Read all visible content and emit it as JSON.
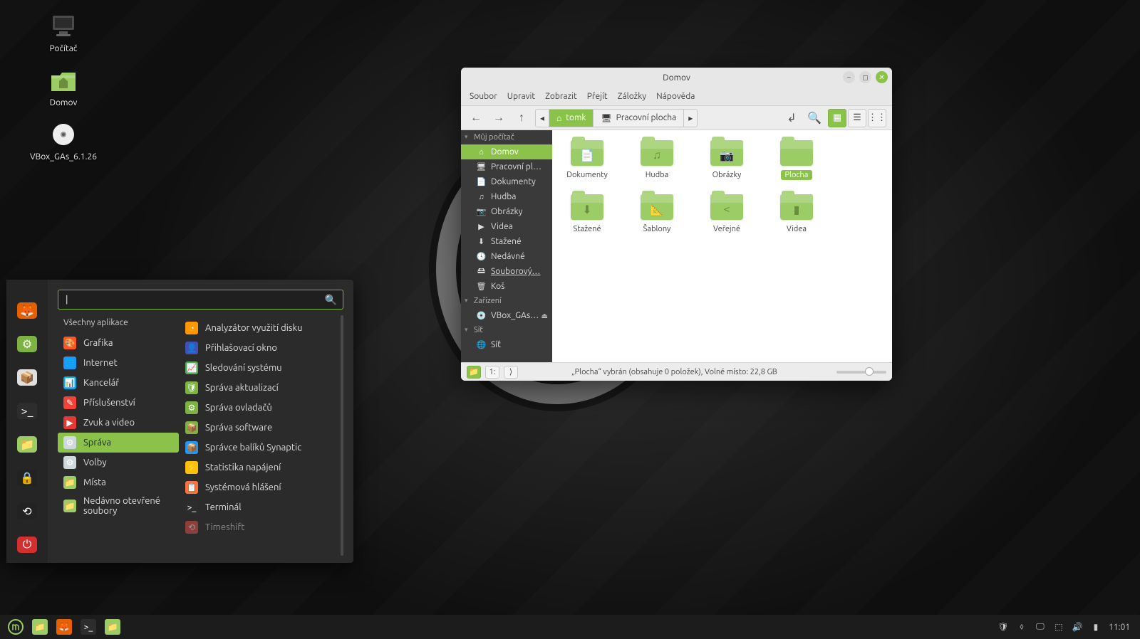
{
  "desktop": {
    "icons": [
      {
        "name": "computer",
        "label": "Počítač"
      },
      {
        "name": "home",
        "label": "Domov"
      },
      {
        "name": "cdrom",
        "label": "VBox_GAs_6.1.26"
      }
    ]
  },
  "file_manager": {
    "title": "Domov",
    "menu": [
      "Soubor",
      "Upravit",
      "Zobrazit",
      "Přejít",
      "Záložky",
      "Nápověda"
    ],
    "path": [
      "tomk",
      "Pracovní plocha"
    ],
    "sidebar": {
      "computer_header": "Můj počítač",
      "computer_items": [
        {
          "icon": "home",
          "label": "Domov",
          "active": true
        },
        {
          "icon": "desktop",
          "label": "Pracovní pl…"
        },
        {
          "icon": "doc",
          "label": "Dokumenty"
        },
        {
          "icon": "music",
          "label": "Hudba"
        },
        {
          "icon": "image",
          "label": "Obrázky"
        },
        {
          "icon": "video",
          "label": "Videa"
        },
        {
          "icon": "download",
          "label": "Stažené"
        },
        {
          "icon": "recent",
          "label": "Nedávné"
        },
        {
          "icon": "disk",
          "label": "Souborový…",
          "link": true
        },
        {
          "icon": "trash",
          "label": "Koš"
        }
      ],
      "devices_header": "Zařízení",
      "devices_items": [
        {
          "icon": "cd",
          "label": "VBox_GAs…",
          "eject": true
        }
      ],
      "network_header": "Síť",
      "network_items": [
        {
          "icon": "net",
          "label": "Síť"
        }
      ]
    },
    "files": [
      {
        "label": "Dokumenty",
        "glyph": "📄"
      },
      {
        "label": "Hudba",
        "glyph": "♫"
      },
      {
        "label": "Obrázky",
        "glyph": "📷"
      },
      {
        "label": "Plocha",
        "glyph": "",
        "selected": true
      },
      {
        "label": "Stažené",
        "glyph": "⬇"
      },
      {
        "label": "Šablony",
        "glyph": "📐"
      },
      {
        "label": "Veřejné",
        "glyph": "<"
      },
      {
        "label": "Videa",
        "glyph": "▮"
      }
    ],
    "status_text": "„Plocha“ vybrán (obsahuje 0 položek), Volné místo: 22,8 GB"
  },
  "app_menu": {
    "search_value": "|",
    "all_apps_label": "Všechny aplikace",
    "favorites": [
      {
        "name": "firefox",
        "bg": "#e66000",
        "glyph": "🦊"
      },
      {
        "name": "onboard",
        "bg": "#7cb342",
        "glyph": "⚙"
      },
      {
        "name": "software",
        "bg": "#e0e0e0",
        "glyph": "📦"
      },
      {
        "name": "terminal",
        "bg": "#2d2d2d",
        "glyph": ">_"
      },
      {
        "name": "files",
        "bg": "#9ccc65",
        "glyph": "📁"
      },
      {
        "name": "lock",
        "bg": "#222",
        "glyph": "🔒"
      },
      {
        "name": "logout",
        "bg": "#222",
        "glyph": "⟲"
      },
      {
        "name": "power",
        "bg": "#d32f2f",
        "glyph": "⏻"
      }
    ],
    "categories": [
      {
        "label": "Grafika",
        "bg": "#ff5722",
        "glyph": "🎨"
      },
      {
        "label": "Internet",
        "bg": "#2196f3",
        "glyph": "🌐"
      },
      {
        "label": "Kancelář",
        "bg": "#03a9f4",
        "glyph": "📊"
      },
      {
        "label": "Příslušenství",
        "bg": "#f44336",
        "glyph": "✎"
      },
      {
        "label": "Zvuk a video",
        "bg": "#e53935",
        "glyph": "▶"
      },
      {
        "label": "Správa",
        "bg": "#cfd8dc",
        "glyph": "⚙",
        "active": true
      },
      {
        "label": "Volby",
        "bg": "#cfd8dc",
        "glyph": "⚙"
      },
      {
        "label": "Místa",
        "bg": "#9ccc65",
        "glyph": "📁"
      },
      {
        "label": "Nedávno otevřené soubory",
        "bg": "#9ccc65",
        "glyph": "📁"
      }
    ],
    "apps": [
      {
        "label": "Analyzátor využití disku",
        "bg": "#ff9800",
        "glyph": "◔"
      },
      {
        "label": "Přihlašovací okno",
        "bg": "#3f51b5",
        "glyph": "👤"
      },
      {
        "label": "Sledování systému",
        "bg": "#4caf50",
        "glyph": "📈"
      },
      {
        "label": "Správa aktualizací",
        "bg": "#7cb342",
        "glyph": "🛡"
      },
      {
        "label": "Správa ovladačů",
        "bg": "#7cb342",
        "glyph": "⚙"
      },
      {
        "label": "Správa software",
        "bg": "#7cb342",
        "glyph": "📦"
      },
      {
        "label": "Správce balíků Synaptic",
        "bg": "#2196f3",
        "glyph": "📦"
      },
      {
        "label": "Statistika napájení",
        "bg": "#ffc107",
        "glyph": "⚡"
      },
      {
        "label": "Systémová hlášení",
        "bg": "#ff7043",
        "glyph": "📋"
      },
      {
        "label": "Terminál",
        "bg": "#2d2d2d",
        "glyph": ">_"
      },
      {
        "label": "Timeshift",
        "bg": "#ef5350",
        "glyph": "⟲",
        "dim": true
      }
    ]
  },
  "taskbar": {
    "time": "11:01",
    "launchers": [
      {
        "name": "menu",
        "glyph": "◎",
        "bg": ""
      },
      {
        "name": "show-desktop",
        "glyph": "📁",
        "bg": "#9ccc65"
      },
      {
        "name": "firefox",
        "glyph": "🦊",
        "bg": "#e66000"
      },
      {
        "name": "terminal",
        "glyph": ">_",
        "bg": "#2d2d2d"
      },
      {
        "name": "files",
        "glyph": "📁",
        "bg": "#9ccc65"
      }
    ],
    "tray": [
      {
        "name": "updates",
        "glyph": "🛡"
      },
      {
        "name": "shield",
        "glyph": "⬨"
      },
      {
        "name": "display",
        "glyph": "🖵"
      },
      {
        "name": "network",
        "glyph": "⬚"
      },
      {
        "name": "sound",
        "glyph": "🔊"
      },
      {
        "name": "battery",
        "glyph": "▮"
      }
    ]
  }
}
